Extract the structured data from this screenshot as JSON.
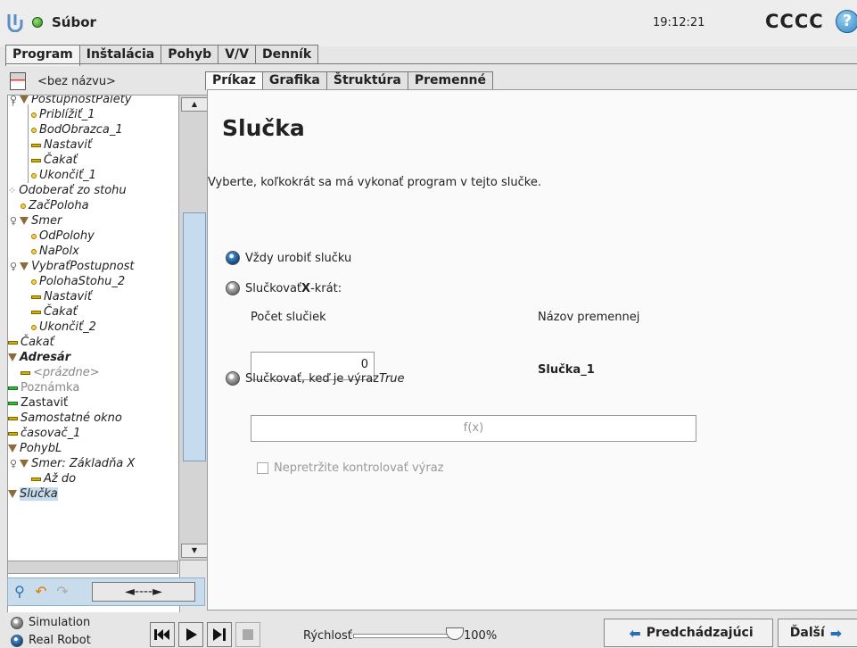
{
  "header": {
    "file_menu": "Súbor",
    "time": "19:12:21",
    "robot_name": "CCCC",
    "help": "?"
  },
  "main_tabs": [
    {
      "label": "Program"
    },
    {
      "label": "Inštalácia"
    },
    {
      "label": "Pohyb"
    },
    {
      "label": "V/V"
    },
    {
      "label": "Denník"
    }
  ],
  "program_name": "<bez názvu>",
  "tree": [
    "PostupnostPalety",
    "Priblížiť_1",
    "BodObrazca_1",
    "Nastaviť",
    "Čakať",
    "Ukončiť_1",
    "Odoberať zo stohu",
    "ZačPoloha",
    "Smer",
    "OdPolohy",
    "NaPolx",
    "VybraťPostupnost",
    "PolohaStohu_2",
    "Nastaviť",
    "Čakať",
    "Ukončiť_2",
    "Čakať",
    "Adresár",
    "<prázdne>",
    "Poznámka",
    "Zastaviť",
    "Samostatné okno",
    "časovač_1",
    "PohybL",
    "Smer: Základňa X",
    "Až do",
    "Slučka"
  ],
  "move_arrows": "◄----►",
  "content_tabs": [
    {
      "label": "Príkaz"
    },
    {
      "label": "Grafika"
    },
    {
      "label": "Štruktúra"
    },
    {
      "label": "Premenné"
    }
  ],
  "content": {
    "title": "Slučka",
    "description": "Vyberte, koľkokrát sa má vykonať program v tejto slučke.",
    "radio_always": "Vždy urobiť slučku",
    "radio_x_times_pre": "Slučkovať ",
    "radio_x_times_x": "X",
    "radio_x_times_post": "-krát:",
    "loop_count_label": "Počet slučiek",
    "loop_count_value": "0",
    "var_label": "Názov premennej",
    "var_name": "Slučka_1",
    "radio_expr_pre": "Slučkovať, keď je výraz ",
    "radio_expr_true": "True",
    "expr_placeholder": "f(x)",
    "continuous_check": "Nepretržite kontrolovať výraz"
  },
  "footer": {
    "simulation": "Simulation",
    "real_robot": "Real Robot",
    "speed_label": "Rýchlosť",
    "speed_value": "100%",
    "speed_fraction": 1.0,
    "prev_button": "Predchádzajúci",
    "next_button": "Ďalší"
  }
}
